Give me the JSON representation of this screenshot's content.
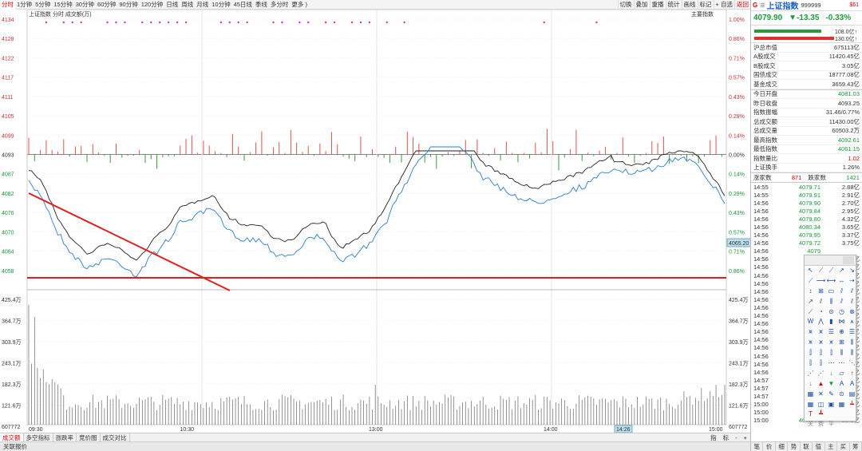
{
  "toolbar": {
    "periods": [
      "分时",
      "1分钟",
      "5分钟",
      "15分钟",
      "30分钟",
      "60分钟",
      "90分钟",
      "120分钟",
      "日线",
      "周线",
      "月线",
      "10分钟",
      "45日线",
      "季线",
      "多分时",
      "更多 )"
    ],
    "active_period": 0,
    "buttons": [
      "切换",
      "叠加",
      "重播",
      "统计",
      "画线",
      "标记",
      "+ 自选"
    ],
    "return_label": "返回"
  },
  "chart": {
    "legend": "上证指数  分时 成交额(万)",
    "main_indicator_label": "主要指数",
    "price_left_labels": [
      "4134",
      "4128",
      "4122",
      "4117",
      "4111",
      "4105",
      "4099",
      "4093",
      "4087",
      "4082",
      "4076",
      "4070",
      "4064",
      "4058"
    ],
    "pct_right_labels": [
      "1.00%",
      "0.86%",
      "0.71%",
      "0.57%",
      "0.43%",
      "0.29%",
      "0.14%",
      "0.00%",
      "0.14%",
      "0.29%",
      "0.43%",
      "0.57%",
      "0.71%",
      "0.86%"
    ],
    "vol_left_labels": [
      "425.4万",
      "364.7万",
      "303.9万",
      "243.1万",
      "182.3万",
      "121.6万",
      "607772"
    ],
    "vol_right_labels": [
      "425.4万",
      "364.7万",
      "303.9万",
      "243.1万",
      "182.3万",
      "121.6万",
      "607772"
    ],
    "time_labels": [
      "09:30",
      "10:30",
      "13:00",
      "14:00",
      "15:00"
    ],
    "cursor_time": "14:26",
    "cursor_price": "4065.20",
    "colors": {
      "price_line": "#2a7fd0",
      "avg_line": "#222222",
      "up": "#e05050",
      "down": "#3a9a3a",
      "trend": "#e02020",
      "signal": "#d030d0"
    }
  },
  "bottom_tabs": {
    "tabs": [
      "成交额",
      "多空指标",
      "涨跌率",
      "竞价图",
      "成交对比"
    ],
    "active": 0,
    "right": [
      "指",
      "标",
      "-",
      "+"
    ]
  },
  "status_bar": {
    "left": "关联报价",
    "right": [
      "诊股",
      "F10",
      "分析"
    ]
  },
  "right_panel": {
    "g_label": "G",
    "name": "上证指数",
    "code": "999999",
    "flag": "$61",
    "price": "4079.90",
    "change": "▼-13.35",
    "change_pct": "-0.33%",
    "bar1_label": "108.0亿↑",
    "bar2_label": "130.0亿↑",
    "stats1": [
      {
        "k": "沪总市值",
        "v": "675113亿",
        "c": "#333"
      },
      {
        "k": "A股成交",
        "v": "11420.45亿",
        "c": "#333"
      },
      {
        "k": "B股成交",
        "v": "3.05亿",
        "c": "#333"
      },
      {
        "k": "国债成交",
        "v": "18777.08亿",
        "c": "#333"
      },
      {
        "k": "基金成交",
        "v": "3659.43亿",
        "c": "#333"
      }
    ],
    "stats2": [
      {
        "k": "今日开盘",
        "v": "4081.03",
        "c": "#1a9a3a"
      },
      {
        "k": "昨日收盘",
        "v": "4093.25",
        "c": "#333"
      },
      {
        "k": "指数振幅",
        "v": "31.46/0.77%",
        "c": "#333"
      },
      {
        "k": "总成交额",
        "v": "11430.00亿",
        "c": "#333"
      },
      {
        "k": "总成交量",
        "v": "60503.2万",
        "c": "#333"
      },
      {
        "k": "最高指数",
        "v": "4092.61",
        "c": "#1a9a3a"
      },
      {
        "k": "最低指数",
        "v": "4061.15",
        "c": "#1a9a3a"
      },
      {
        "k": "指数量比",
        "v": "1.02",
        "c": "#d00"
      },
      {
        "k": "上证换手",
        "v": "1.26%",
        "c": "#333"
      }
    ],
    "up_label": "涨家数",
    "up_count": "871",
    "down_label": "跌家数",
    "down_count": "1421",
    "ticks": [
      {
        "t": "14:55",
        "p": "4079.71",
        "v": "2.88亿"
      },
      {
        "t": "14:55",
        "p": "4079.91",
        "v": "2.91亿"
      },
      {
        "t": "14:56",
        "p": "4079.90",
        "v": "2.70亿"
      },
      {
        "t": "14:56",
        "p": "4079.84",
        "v": "2.95亿"
      },
      {
        "t": "14:56",
        "p": "4079.80",
        "v": "4.32亿"
      },
      {
        "t": "14:56",
        "p": "4080.34",
        "v": "3.65亿"
      },
      {
        "t": "14:56",
        "p": "4079.95",
        "v": "3.37亿"
      },
      {
        "t": "14:56",
        "p": "4079.72",
        "v": "3.75亿"
      },
      {
        "t": "14:56",
        "p": "4079",
        "v": ""
      },
      {
        "t": "14:56",
        "p": "4080",
        "v": "9亿"
      },
      {
        "t": "14:56",
        "p": "4080",
        "v": "9亿"
      },
      {
        "t": "14:56",
        "p": "4080",
        "v": "9亿"
      },
      {
        "t": "14:56",
        "p": "4080",
        "v": "3亿"
      },
      {
        "t": "14:56",
        "p": "4080",
        "v": "0亿"
      },
      {
        "t": "14:56",
        "p": "4080",
        "v": "9亿"
      },
      {
        "t": "14:56",
        "p": "4079",
        "v": "2亿"
      },
      {
        "t": "14:56",
        "p": "4080",
        "v": "9亿"
      },
      {
        "t": "14:56",
        "p": "4079",
        "v": "7亿"
      },
      {
        "t": "14:56",
        "p": "4079",
        "v": "3亿"
      },
      {
        "t": "14:56",
        "p": "4079",
        "v": "1亿"
      },
      {
        "t": "14:56",
        "p": "4079",
        "v": "2亿"
      },
      {
        "t": "14:56",
        "p": "4080",
        "v": "4亿"
      },
      {
        "t": "14:56",
        "p": "4080",
        "v": "5亿"
      },
      {
        "t": "14:56",
        "p": "4080",
        "v": "5亿"
      },
      {
        "t": "14:57",
        "p": "4080",
        "v": "1亿"
      },
      {
        "t": "14:57",
        "p": "4080",
        "v": "0亿"
      },
      {
        "t": "14:57",
        "p": "4080",
        "v": "5亿"
      },
      {
        "t": "15:00",
        "p": "4080",
        "v": "2亿"
      },
      {
        "t": "15:00",
        "p": "4080",
        "v": "9亿"
      },
      {
        "t": "15:00",
        "p": "4079.90",
        "v": "29.1亿"
      }
    ],
    "vtabs": [
      "笔",
      "价",
      "细",
      "势",
      "联",
      "值",
      "主",
      "买",
      "筹"
    ]
  },
  "draw_tools": {
    "glyphs": [
      "↖",
      "⟋",
      "⟋",
      "↗",
      "↘",
      "⟋",
      "⟶",
      "⟷",
      "↔",
      "⇢",
      "↕",
      "⊞",
      "▭",
      "⫽",
      "⫽",
      "↗",
      "⫽",
      "⫼",
      "⫽",
      "⫽",
      "⟋",
      "◔",
      "⊙",
      "◷",
      "⊗",
      "W",
      "⋀",
      "▮",
      "⋈",
      "⩚",
      "⩙",
      "⩙",
      "☰",
      "⊕",
      "☰",
      "⩙",
      "⩙",
      "⩙",
      "⊞",
      "⫼",
      "⫿",
      "⫿",
      "⫿",
      "⫼",
      "⫼",
      "⫿",
      "⫿",
      "⋯",
      "⋯",
      "⋱",
      "⋰",
      "⋰",
      "↓",
      "▱",
      "↑",
      "↓",
      "▲",
      "▼",
      "A",
      "A",
      "▦",
      "✕",
      "✎",
      "⊙",
      "▤",
      "▦",
      "◫",
      "▣",
      "▦",
      "┷",
      "T",
      "┻",
      "",
      ""
    ],
    "footer": [
      "关",
      "费",
      "平"
    ]
  }
}
